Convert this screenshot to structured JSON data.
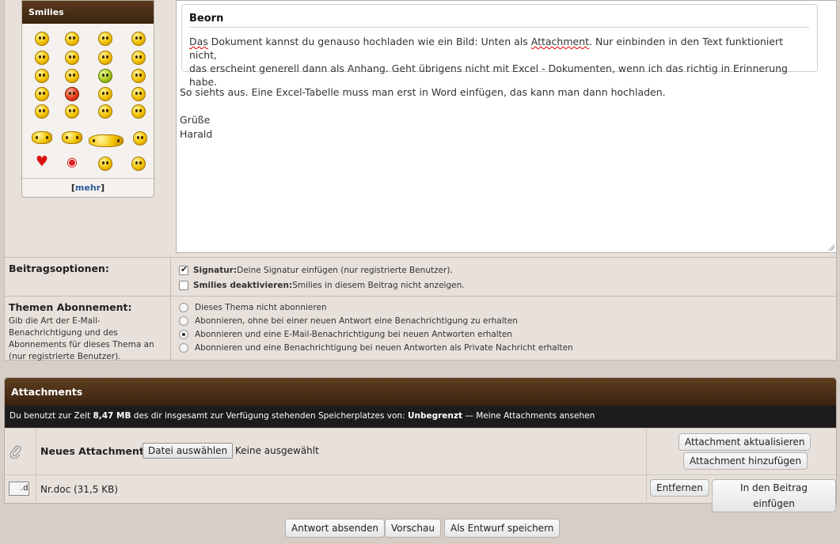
{
  "smilies": {
    "title": "Smilies",
    "more_link": "mehr",
    "icons": [
      "smile",
      "wink",
      "cool",
      "biggrin",
      "tongue",
      "confused",
      "embarrassed",
      "frown",
      "rolleyes",
      "redface",
      "sick",
      "mad",
      "thumbsup",
      "angry",
      "eek",
      "unsure",
      "shy",
      "puzzled",
      "shocked",
      "surprised",
      "rolleyes2",
      "angel",
      "applause",
      "thinking",
      "heart",
      "kiss",
      "whistle",
      "wacko"
    ]
  },
  "editor": {
    "quote_author": "Beorn",
    "quote_line1_a": "Das",
    "quote_line1_b": " Dokument kannst du genauso hochladen wie ein Bild: Unten als ",
    "quote_line1_c": "Attachment",
    "quote_line1_d": ". Nur einbinden in den Text funktioniert nicht,",
    "quote_line2": "das erscheint generell dann als Anhang. Geht übrigens nicht mit Excel - Dokumenten, wenn ich das richtig in Erinnerung habe.",
    "body_line1": "So siehts aus. Eine Excel-Tabelle muss man erst in Word einfügen, das kann man dann hochladen.",
    "body_greeting": "Grüße",
    "body_name": "Harald"
  },
  "options": {
    "label": "Beitragsoptionen:",
    "signature_bold": "Signatur:",
    "signature_text": " Deine Signatur einfügen (nur registrierte Benutzer).",
    "signature_checked": true,
    "smilies_bold": "Smilies deaktivieren:",
    "smilies_text": " Smilies in diesem Beitrag nicht anzeigen.",
    "smilies_checked": false
  },
  "subscription": {
    "label": "Themen Abonnement:",
    "desc": "Gib die Art der E-Mail-Benachrichtigung und des Abonnements für dieses Thema an (nur registrierte Benutzer).",
    "choices": [
      "Dieses Thema nicht abonnieren",
      "Abonnieren, ohne bei einer neuen Antwort eine Benachrichtigung zu erhalten",
      "Abonnieren und eine E-Mail-Benachrichtigung bei neuen Antworten erhalten",
      "Abonnieren und eine Benachrichtigung bei neuen Antworten als Private Nachricht erhalten"
    ],
    "selected_index": 2
  },
  "attachments": {
    "title": "Attachments",
    "info_prefix": "Du benutzt zur Zeit ",
    "info_used": "8,47 MB",
    "info_mid": " des dir insgesamt zur Verfügung stehenden Speicherplatzes von: ",
    "info_total": "Unbegrenzt",
    "info_suffix": " — Meine Attachments ansehen",
    "new_label": "Neues Attachment:",
    "file_button": "Datei auswählen",
    "file_status": "Keine ausgewählt",
    "update_button": "Attachment aktualisieren",
    "add_button": "Attachment hinzufügen",
    "file_name": "Nr.doc (31,5 KB)",
    "file_icon_alt": ".d",
    "remove_button": "Entfernen",
    "insert_button": "In den Beitrag einfügen"
  },
  "actions": {
    "submit": "Antwort absenden",
    "preview": "Vorschau",
    "draft": "Als Entwurf speichern"
  }
}
